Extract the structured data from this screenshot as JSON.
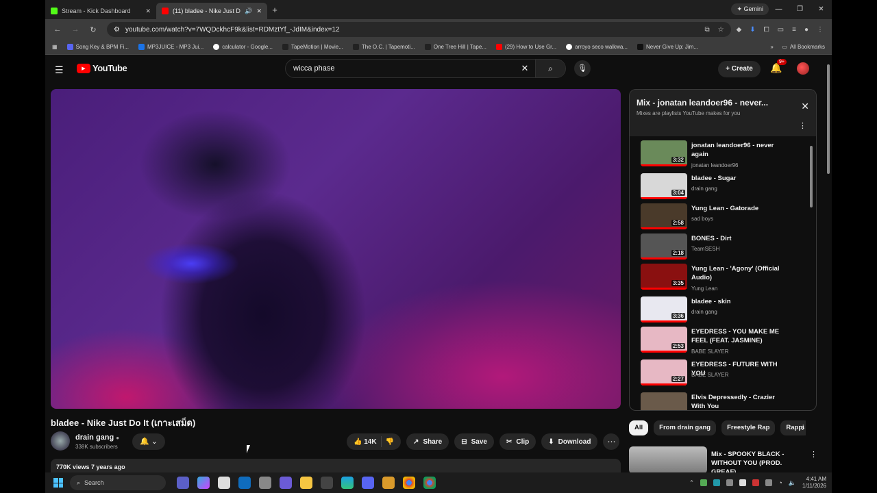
{
  "browser": {
    "tabs": [
      {
        "title": "Stream - Kick Dashboard",
        "favicon_color": "#53fc18"
      },
      {
        "title": "(11) bladee - Nike Just Do I",
        "favicon_color": "#ff0000"
      }
    ],
    "gemini_label": "Gemini",
    "url": "youtube.com/watch?v=7WQDckhcF9k&list=RDMztYf_-JdIM&index=12",
    "bookmarks": [
      "Song Key & BPM Fi...",
      "MP3JUICE - MP3 Jui...",
      "calculator - Google...",
      "TapeMotion | Movie...",
      "The O.C. | Tapemoti...",
      "One Tree Hill | Tape...",
      "(29) How to Use Gr...",
      "arroyo seco walkwa...",
      "Never Give Up: Jim..."
    ],
    "all_bookmarks": "All Bookmarks"
  },
  "yt": {
    "logo": "YouTube",
    "search_value": "wicca phase",
    "create": "Create",
    "notif": "9+",
    "video_title": "bladee - Nike Just Do It (เกาะเสม็ด)",
    "channel": "drain gang",
    "subs": "338K subscribers",
    "likes": "14K",
    "share": "Share",
    "save": "Save",
    "clip": "Clip",
    "download": "Download",
    "views": "770K views  7 years ago"
  },
  "playlist": {
    "title": "Mix - jonatan leandoer96 - never...",
    "subtitle": "Mixes are playlists YouTube makes for you",
    "items": [
      {
        "title": "jonatan leandoer96 - never again",
        "artist": "jonatan leandoer96",
        "dur": "3:32",
        "thumb": "#6a8a5a"
      },
      {
        "title": "bladee - Sugar",
        "artist": "drain gang",
        "dur": "3:04",
        "thumb": "#d8d8d8"
      },
      {
        "title": "Yung Lean - Gatorade",
        "artist": "sad boys",
        "dur": "2:58",
        "thumb": "#4a3a2a"
      },
      {
        "title": "BONES - Dirt",
        "artist": "TeamSESH",
        "dur": "2:18",
        "thumb": "#555555"
      },
      {
        "title": "Yung Lean - 'Agony' (Official Audio)",
        "artist": "Yung Lean",
        "dur": "3:35",
        "thumb": "#8a1010"
      },
      {
        "title": "bladee - skin",
        "artist": "drain gang",
        "dur": "3:36",
        "thumb": "#e8e8f0"
      },
      {
        "title": "EYEDRESS - YOU MAKE ME FEEL (FEAT. JASMINE)",
        "artist": "BABE SLAYER",
        "dur": "2:53",
        "thumb": "#e7b8c4"
      },
      {
        "title": "EYEDRESS - FUTURE WITH YOU",
        "artist": "BABE SLAYER",
        "dur": "2:27",
        "thumb": "#e7b8c4"
      },
      {
        "title": "Elvis Depressedly - Crazier With You",
        "artist": "",
        "dur": "",
        "thumb": "#6a5a4a"
      }
    ]
  },
  "chips": [
    "All",
    "From drain gang",
    "Freestyle Rap",
    "Rappi"
  ],
  "recommendation": {
    "title": "Mix - SPOOKY BLACK - WITHOUT YOU (PROD. GREAF)"
  },
  "taskbar": {
    "search": "Search",
    "time": "4:41 AM",
    "date": "1/11/2026"
  }
}
